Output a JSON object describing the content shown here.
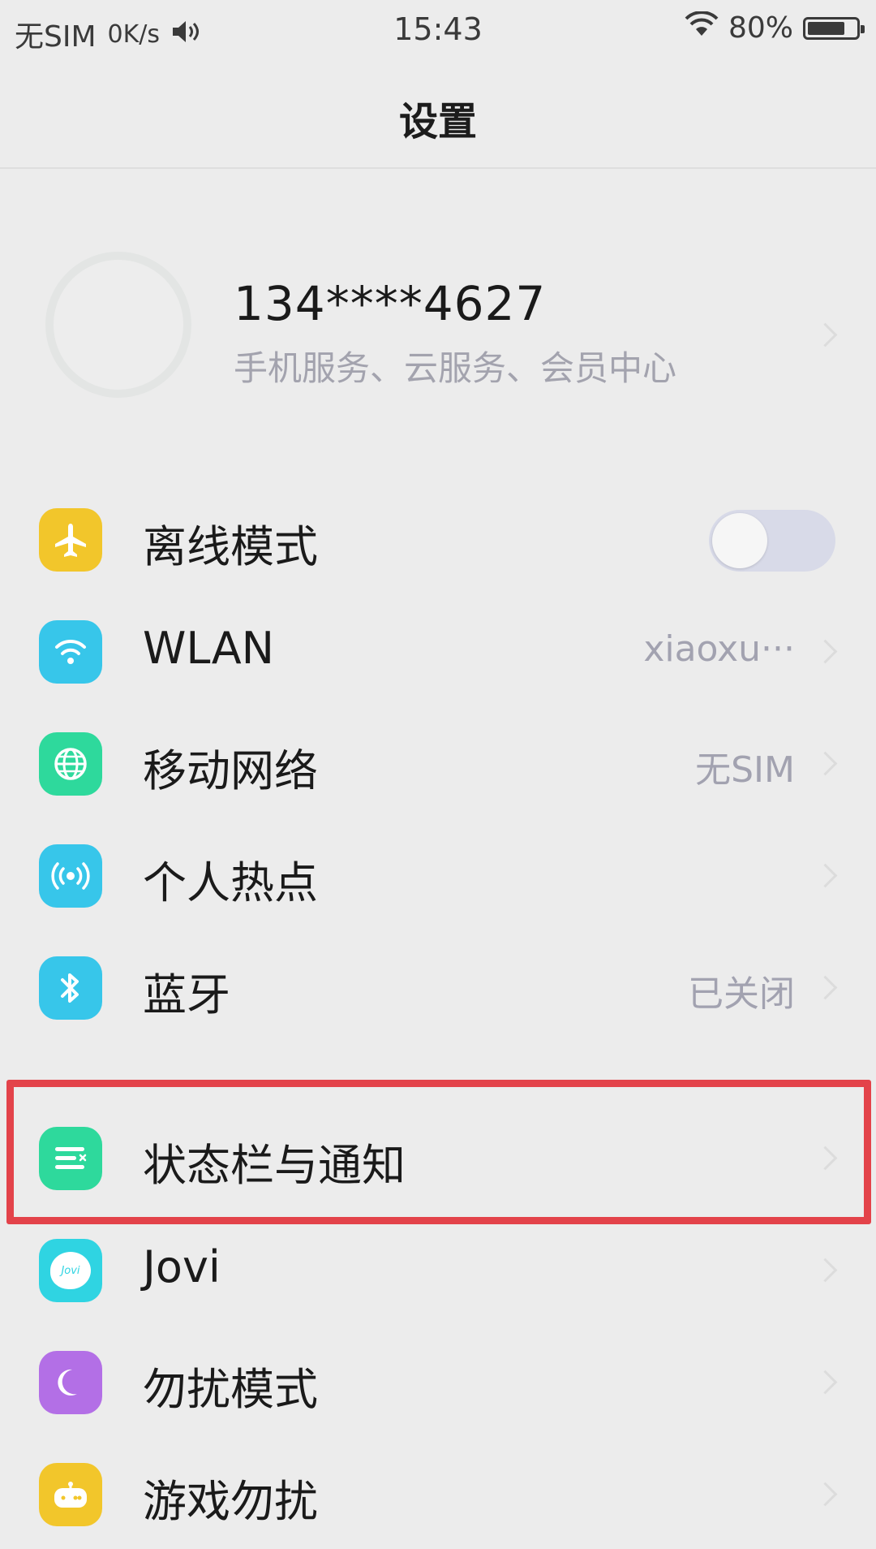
{
  "status_bar": {
    "carrier": "无SIM",
    "speed": "0K/s",
    "time": "15:43",
    "battery_text": "80%",
    "battery_level": 0.8,
    "icons": [
      "volume-icon",
      "wifi-icon",
      "battery-icon"
    ]
  },
  "header": {
    "title": "设置"
  },
  "account": {
    "phone": "134****4627",
    "subtitle": "手机服务、云服务、会员中心"
  },
  "settings": [
    {
      "label": "离线模式",
      "icon": "airplane-icon",
      "color": "#f2c62b",
      "toggle": false
    },
    {
      "label": "WLAN",
      "icon": "wifi-icon",
      "color": "#37c6ea",
      "value": "xiaoxu···"
    },
    {
      "label": "移动网络",
      "icon": "globe-icon",
      "color": "#2ed99c",
      "value": "无SIM"
    },
    {
      "label": "个人热点",
      "icon": "hotspot-icon",
      "color": "#37c6ea"
    },
    {
      "label": "蓝牙",
      "icon": "bluetooth-icon",
      "color": "#37c6ea",
      "value": "已关闭"
    },
    {
      "label": "状态栏与通知",
      "icon": "notification-list-icon",
      "color": "#2ed99c",
      "highlighted": true
    },
    {
      "label": "Jovi",
      "icon": "jovi-icon",
      "color": "#2fd4e2",
      "icon_text": "Jovi"
    },
    {
      "label": "勿扰模式",
      "icon": "moon-icon",
      "color": "#b36fe6"
    },
    {
      "label": "游戏勿扰",
      "icon": "gamepad-icon",
      "color": "#f2c62b"
    }
  ],
  "colors": {
    "highlight_border": "#e3434a",
    "background": "#ececec"
  }
}
